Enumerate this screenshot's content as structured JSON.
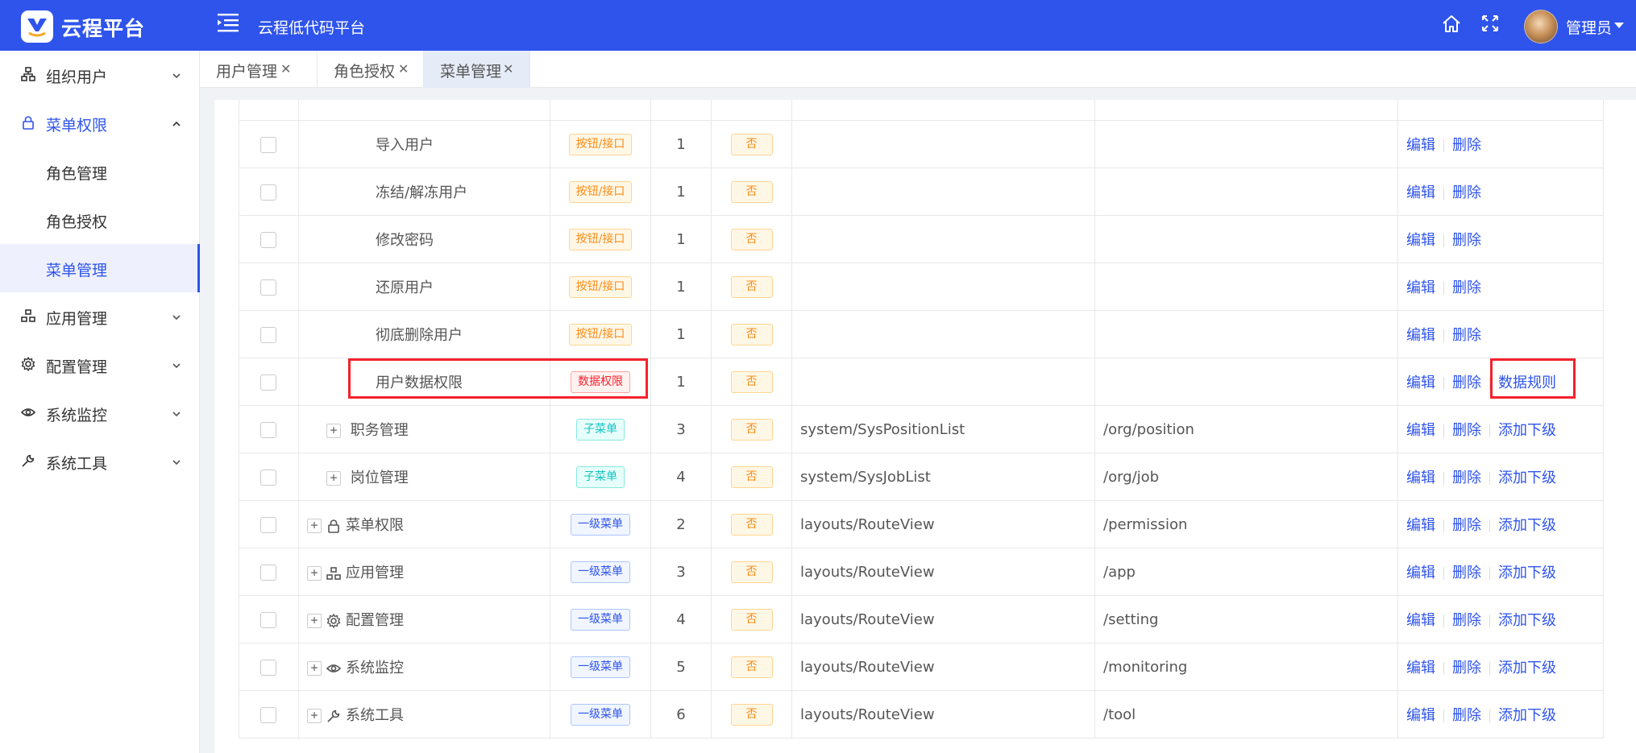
{
  "header": {
    "brand": "云程平台",
    "title": "云程低代码平台",
    "user_name": "管理员"
  },
  "sidebar": {
    "items": [
      {
        "label": "组织用户",
        "icon": "org-icon"
      },
      {
        "label": "菜单权限",
        "icon": "lock-icon"
      },
      {
        "label": "角色管理"
      },
      {
        "label": "角色授权"
      },
      {
        "label": "菜单管理"
      },
      {
        "label": "应用管理",
        "icon": "app-icon"
      },
      {
        "label": "配置管理",
        "icon": "gear-icon"
      },
      {
        "label": "系统监控",
        "icon": "eye-icon"
      },
      {
        "label": "系统工具",
        "icon": "wrench-icon"
      }
    ]
  },
  "tabs": [
    {
      "label": "用户管理"
    },
    {
      "label": "角色授权"
    },
    {
      "label": "菜单管理"
    }
  ],
  "table": {
    "rows": [
      {
        "name": "导入用户",
        "type": "按钮/接口",
        "order": "1",
        "hidden": "否",
        "component": "",
        "path": "",
        "actions": [
          "编辑",
          "删除"
        ]
      },
      {
        "name": "冻结/解冻用户",
        "type": "按钮/接口",
        "order": "1",
        "hidden": "否",
        "component": "",
        "path": "",
        "actions": [
          "编辑",
          "删除"
        ]
      },
      {
        "name": "修改密码",
        "type": "按钮/接口",
        "order": "1",
        "hidden": "否",
        "component": "",
        "path": "",
        "actions": [
          "编辑",
          "删除"
        ]
      },
      {
        "name": "还原用户",
        "type": "按钮/接口",
        "order": "1",
        "hidden": "否",
        "component": "",
        "path": "",
        "actions": [
          "编辑",
          "删除"
        ]
      },
      {
        "name": "彻底删除用户",
        "type": "按钮/接口",
        "order": "1",
        "hidden": "否",
        "component": "",
        "path": "",
        "actions": [
          "编辑",
          "删除"
        ]
      },
      {
        "name": "用户数据权限",
        "type": "数据权限",
        "order": "1",
        "hidden": "否",
        "component": "",
        "path": "",
        "actions": [
          "编辑",
          "删除",
          "数据规则"
        ]
      },
      {
        "name": "职务管理",
        "type": "子菜单",
        "order": "3",
        "hidden": "否",
        "component": "system/SysPositionList",
        "path": "/org/position",
        "actions": [
          "编辑",
          "删除",
          "添加下级"
        ]
      },
      {
        "name": "岗位管理",
        "type": "子菜单",
        "order": "4",
        "hidden": "否",
        "component": "system/SysJobList",
        "path": "/org/job",
        "actions": [
          "编辑",
          "删除",
          "添加下级"
        ]
      },
      {
        "name": "菜单权限",
        "icon": "lock-icon",
        "type": "一级菜单",
        "order": "2",
        "hidden": "否",
        "component": "layouts/RouteView",
        "path": "/permission",
        "actions": [
          "编辑",
          "删除",
          "添加下级"
        ]
      },
      {
        "name": "应用管理",
        "icon": "app-icon",
        "type": "一级菜单",
        "order": "3",
        "hidden": "否",
        "component": "layouts/RouteView",
        "path": "/app",
        "actions": [
          "编辑",
          "删除",
          "添加下级"
        ]
      },
      {
        "name": "配置管理",
        "icon": "gear-icon",
        "type": "一级菜单",
        "order": "4",
        "hidden": "否",
        "component": "layouts/RouteView",
        "path": "/setting",
        "actions": [
          "编辑",
          "删除",
          "添加下级"
        ]
      },
      {
        "name": "系统监控",
        "icon": "eye-icon",
        "type": "一级菜单",
        "order": "5",
        "hidden": "否",
        "component": "layouts/RouteView",
        "path": "/monitoring",
        "actions": [
          "编辑",
          "删除",
          "添加下级"
        ]
      },
      {
        "name": "系统工具",
        "icon": "wrench-icon",
        "type": "一级菜单",
        "order": "6",
        "hidden": "否",
        "component": "layouts/RouteView",
        "path": "/tool",
        "actions": [
          "编辑",
          "删除",
          "添加下级"
        ]
      }
    ]
  },
  "colors": {
    "primary": "#2f54eb",
    "highlight": "#f5222d",
    "tag_orange": "#fa8c16",
    "tag_red": "#f5222d",
    "tag_cyan": "#13c2c2",
    "tag_blue": "#2f54eb"
  }
}
